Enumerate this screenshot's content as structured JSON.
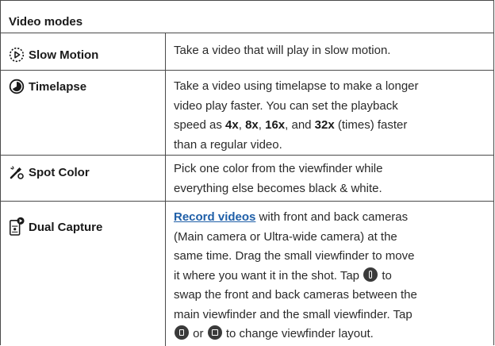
{
  "header": {
    "title": "Video modes"
  },
  "modes": [
    {
      "name": "Slow Motion",
      "icon": "slow-motion-icon",
      "description": "Take a video that will play in slow motion."
    },
    {
      "name": "Timelapse",
      "icon": "timelapse-icon",
      "description": {
        "line1": "Take a video using timelapse to make a longer",
        "line2": "video play faster. You can set the playback",
        "line3_pre": "speed as ",
        "speed1": "4x",
        "sep1": ", ",
        "speed2": "8x",
        "sep2": ", ",
        "speed3": "16x",
        "sep3": ", and ",
        "speed4": "32x",
        "line3_post": " (times) faster",
        "line4": "than a regular video."
      }
    },
    {
      "name": "Spot Color",
      "icon": "spot-color-icon",
      "description": {
        "line1": "Pick one color from the viewfinder while",
        "line2": "everything else becomes black & white."
      }
    },
    {
      "name": "Dual Capture",
      "icon": "dual-capture-icon",
      "description": {
        "link": "Record videos",
        "line1_post": " with front and back cameras",
        "line2": "(Main camera or Ultra-wide camera) at the",
        "line3": "same time. Drag the small viewfinder to move",
        "line4_pre": "it where you want it in the shot. Tap ",
        "line4_post": " to",
        "line5": "swap the front and back cameras between the",
        "line6": "main viewfinder and the small viewfinder. Tap",
        "line7_mid": " or ",
        "line7_post": " to change viewfinder layout."
      }
    }
  ],
  "colors": {
    "border": "#4a4a4a",
    "link": "#1f5fa8",
    "text": "#1a1a1a"
  }
}
